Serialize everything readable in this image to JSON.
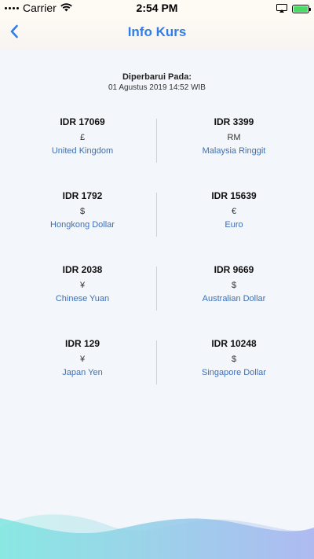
{
  "status_bar": {
    "carrier": "Carrier",
    "time": "2:54 PM",
    "battery_icon": "battery-charging-icon",
    "airplay_icon": "screen-mirror-icon",
    "wifi_icon": "wifi-icon"
  },
  "nav": {
    "title": "Info Kurs",
    "back_icon": "chevron-left-icon",
    "accent": "#2f7ee8"
  },
  "updated": {
    "label": "Diperbarui Pada:",
    "value": "01 Agustus 2019 14:52 WIB"
  },
  "rates": [
    {
      "left": {
        "value": "IDR 17069",
        "symbol": "£",
        "name": "United Kingdom"
      },
      "right": {
        "value": "IDR 3399",
        "symbol": "RM",
        "name": "Malaysia Ringgit"
      }
    },
    {
      "left": {
        "value": "IDR 1792",
        "symbol": "$",
        "name": "Hongkong Dollar"
      },
      "right": {
        "value": "IDR 15639",
        "symbol": "€",
        "name": "Euro"
      }
    },
    {
      "left": {
        "value": "IDR 2038",
        "symbol": "¥",
        "name": "Chinese Yuan"
      },
      "right": {
        "value": "IDR 9669",
        "symbol": "$",
        "name": "Australian Dollar"
      }
    },
    {
      "left": {
        "value": "IDR 129",
        "symbol": "¥",
        "name": "Japan Yen"
      },
      "right": {
        "value": "IDR 10248",
        "symbol": "$",
        "name": "Singapore Dollar"
      }
    }
  ],
  "colors": {
    "currency_name": "#3d6fb8",
    "wave_start": "#7ee6e0",
    "wave_end": "#a7b4f0"
  }
}
